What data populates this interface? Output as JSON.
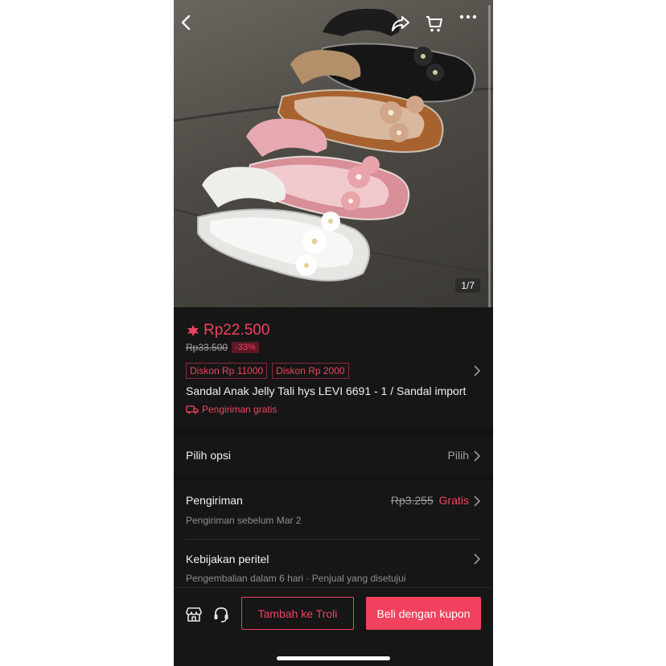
{
  "photo": {
    "counter": "1/7",
    "icons": [
      "back-icon",
      "share-icon",
      "cart-icon",
      "more-icon"
    ]
  },
  "product": {
    "price": "Rp22.500",
    "original_price": "Rp33.500",
    "discount": "-33%",
    "coupons": [
      "Diskon Rp 11000",
      "Diskon Rp 2000"
    ],
    "title": "Sandal Anak Jelly Tali hys LEVI 6691 - 1 / Sandal import",
    "free_shipping": "Pengiriman gratis"
  },
  "options": {
    "label": "Pilih opsi",
    "action": "Pilih"
  },
  "shipping": {
    "label": "Pengiriman",
    "old_price": "Rp3.255",
    "price": "Gratis",
    "sub": "Pengiriman sebelum Mar 2"
  },
  "policy": {
    "label": "Kebijakan peritel",
    "sub": "Pengembalian dalam 6 hari · Penjual yang disetujui"
  },
  "bottom_bar": {
    "add_to_cart": "Tambah ke Troli",
    "buy": "Beli dengan kupon"
  },
  "colors": {
    "accent": "#f0425e",
    "background": "#121212"
  }
}
